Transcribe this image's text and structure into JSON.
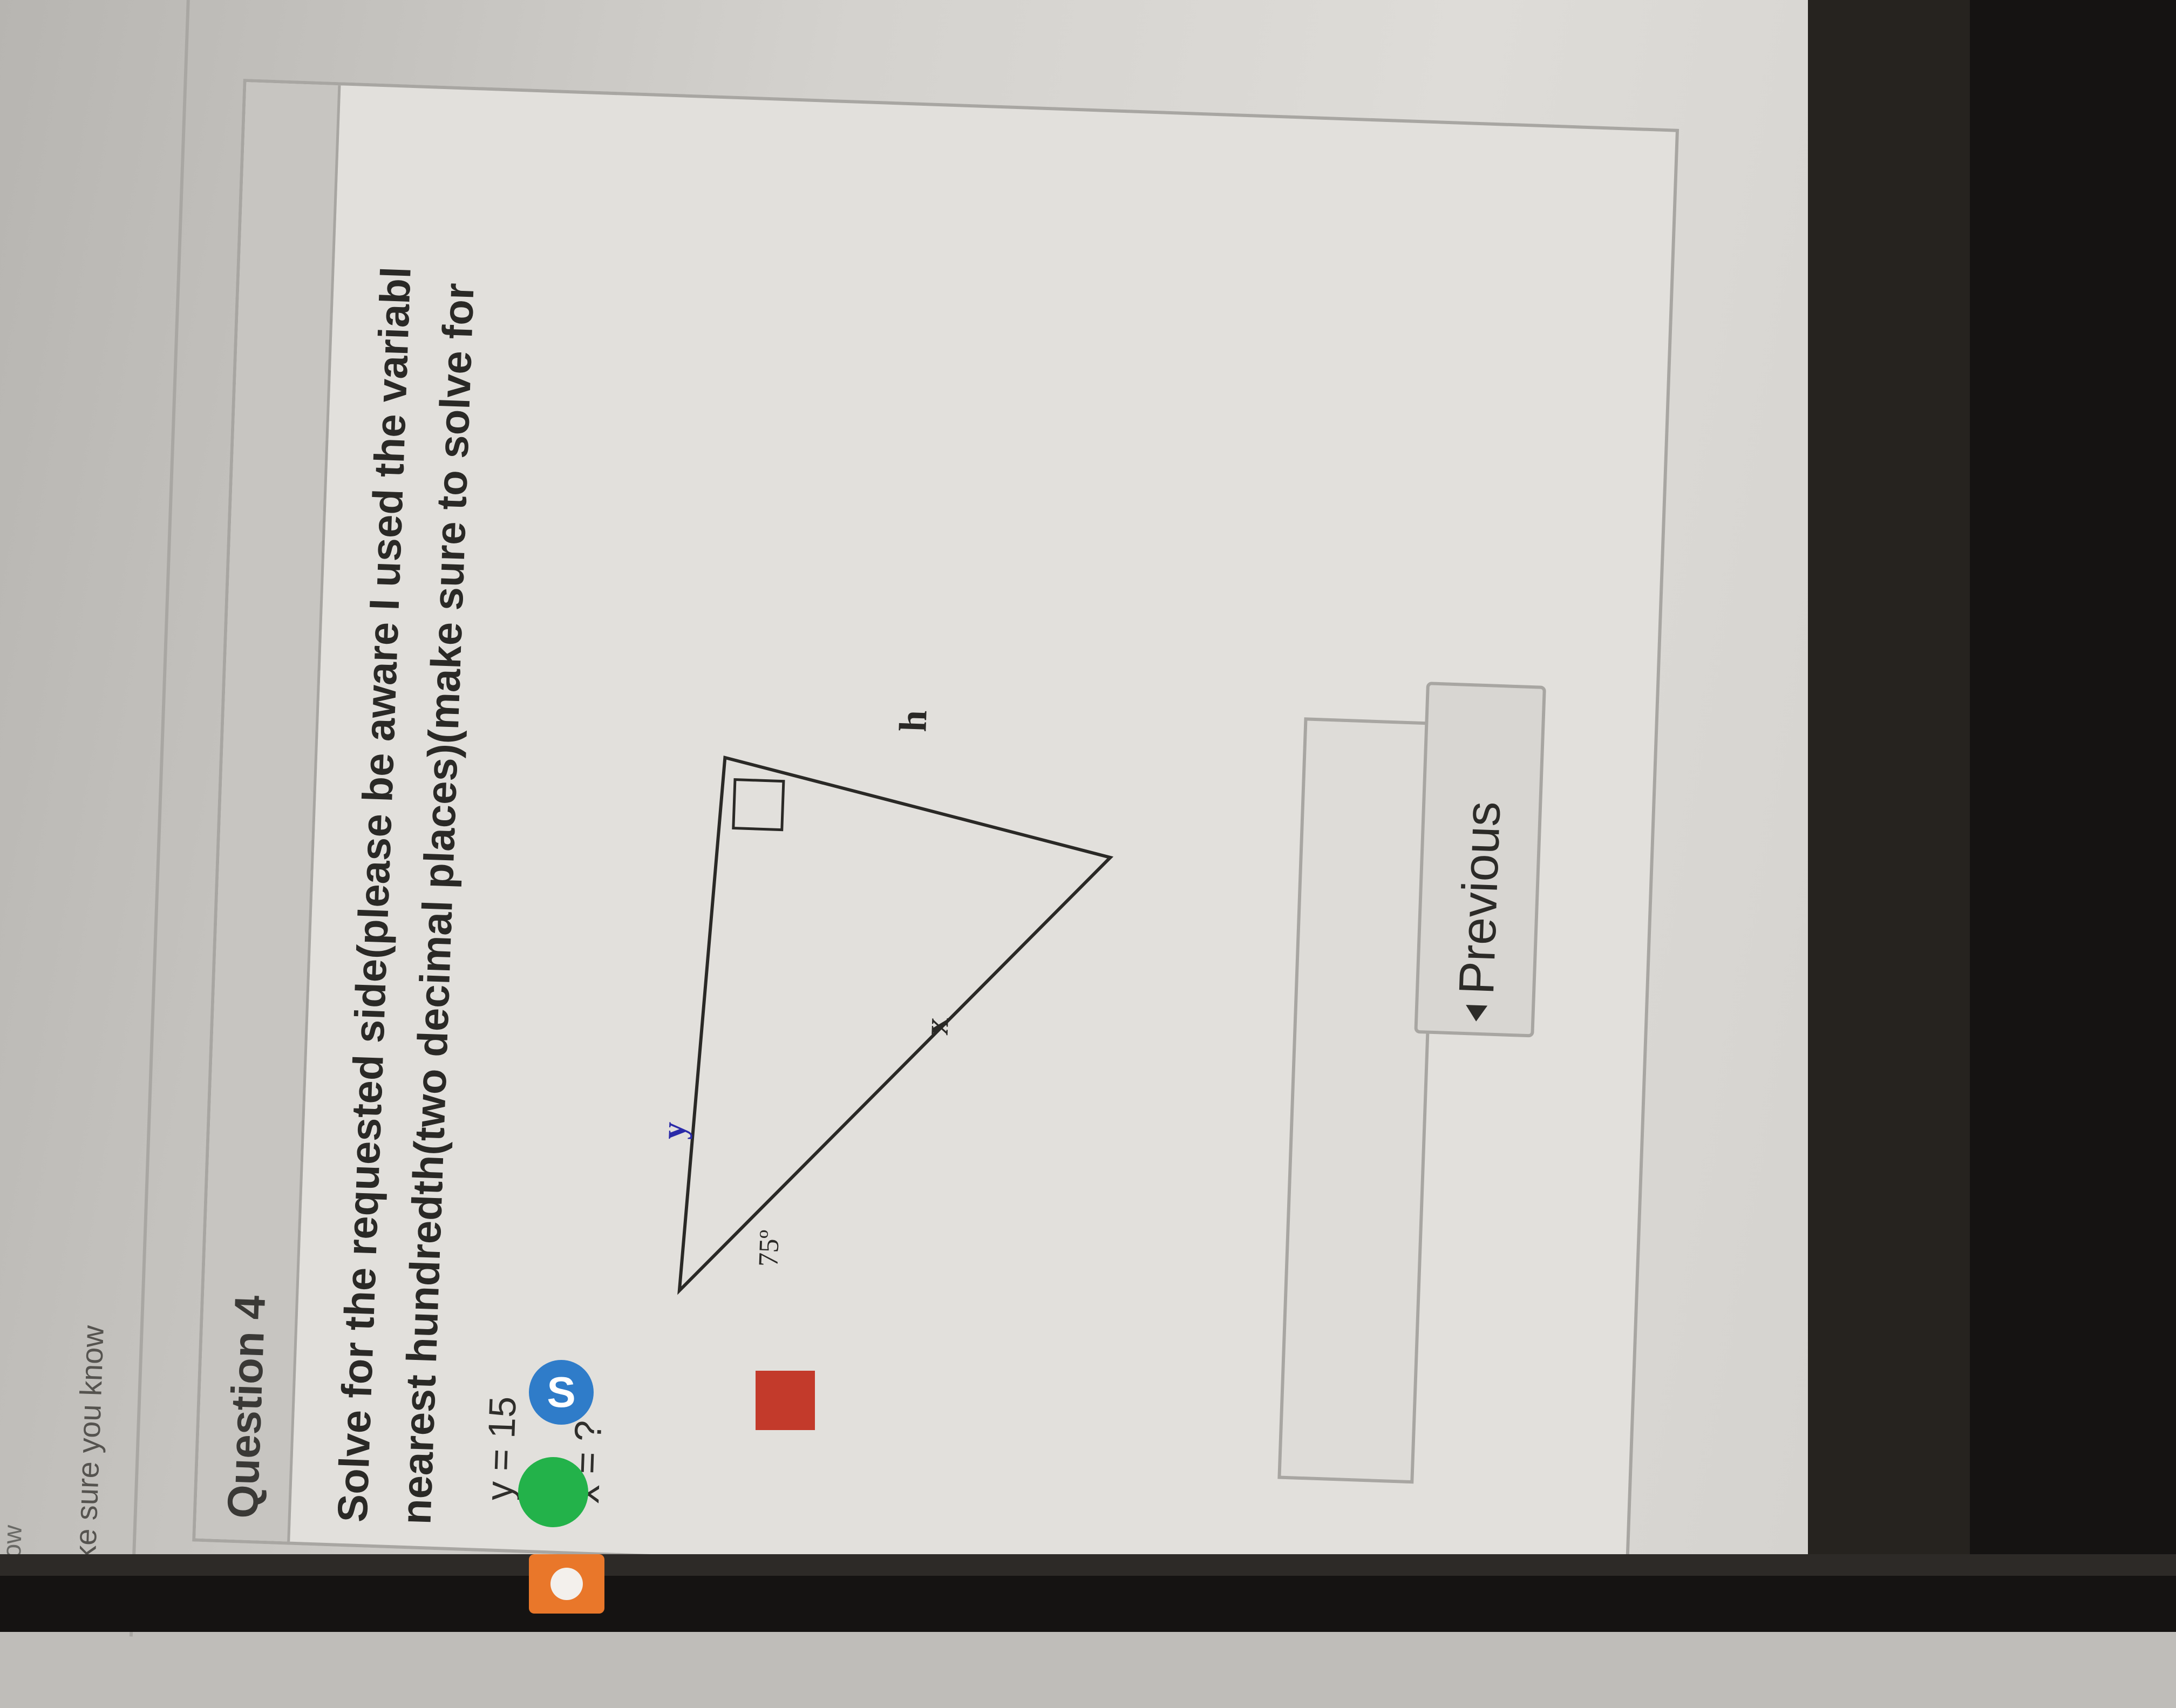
{
  "page": {
    "top_text": "Follow",
    "make_sure": "Make sure you know"
  },
  "question": {
    "title": "Question 4",
    "prompt_line1": "Solve for the requested side(please be aware I used the variabl",
    "prompt_line2": "nearest hundredth(two decimal places)(make sure to solve for",
    "y_eq": "y = 15",
    "x_eq": "x = ?"
  },
  "diagram": {
    "label_y": "y",
    "label_h": "h",
    "label_x": "x",
    "angle": "75º",
    "label_y_color": "#2a2aa8"
  },
  "answer": {
    "value": ""
  },
  "nav": {
    "previous_label": "Previous"
  },
  "taskbar": {
    "icons": [
      "orange-app-icon",
      "spotify-icon",
      "skype-icon",
      "flag-app-icon"
    ],
    "skype_letter": "S"
  }
}
